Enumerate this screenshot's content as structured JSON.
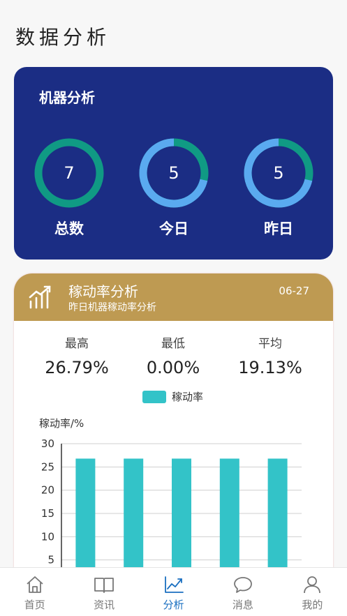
{
  "page": {
    "title": "数据分析"
  },
  "machine": {
    "title": "机器分析",
    "rings": [
      {
        "value": "7",
        "label": "总数",
        "fraction": 1.0
      },
      {
        "value": "5",
        "label": "今日",
        "fraction": 0.714
      },
      {
        "value": "5",
        "label": "昨日",
        "fraction": 0.714
      }
    ],
    "colors": {
      "card": "#1b2d84",
      "ring_base": "#109a84",
      "ring_fill": "#5aaaf0"
    }
  },
  "util": {
    "title": "稼动率分析",
    "subtitle": "昨日机器稼动率分析",
    "date": "06-27",
    "header_color": "#be9a52",
    "stats": [
      {
        "label": "最高",
        "value": "26.79%"
      },
      {
        "label": "最低",
        "value": "0.00%"
      },
      {
        "label": "平均",
        "value": "19.13%"
      }
    ],
    "legend": "稼动率",
    "ylabel": "稼动率/%"
  },
  "chart_data": {
    "type": "bar",
    "series": [
      {
        "name": "稼动率",
        "values": [
          26.79,
          26.79,
          26.79,
          26.79,
          26.79
        ],
        "color": "#33c3c8"
      }
    ],
    "ylim": [
      0,
      30
    ],
    "yticks": [
      "0",
      "5",
      "10",
      "15",
      "20",
      "25",
      "30"
    ],
    "ylabel": "稼动率/%",
    "grid": true
  },
  "nav": [
    {
      "label": "首页",
      "icon": "home-icon",
      "active": false
    },
    {
      "label": "资讯",
      "icon": "book-icon",
      "active": false
    },
    {
      "label": "分析",
      "icon": "chart-icon",
      "active": true
    },
    {
      "label": "消息",
      "icon": "message-icon",
      "active": false
    },
    {
      "label": "我的",
      "icon": "user-icon",
      "active": false
    }
  ]
}
